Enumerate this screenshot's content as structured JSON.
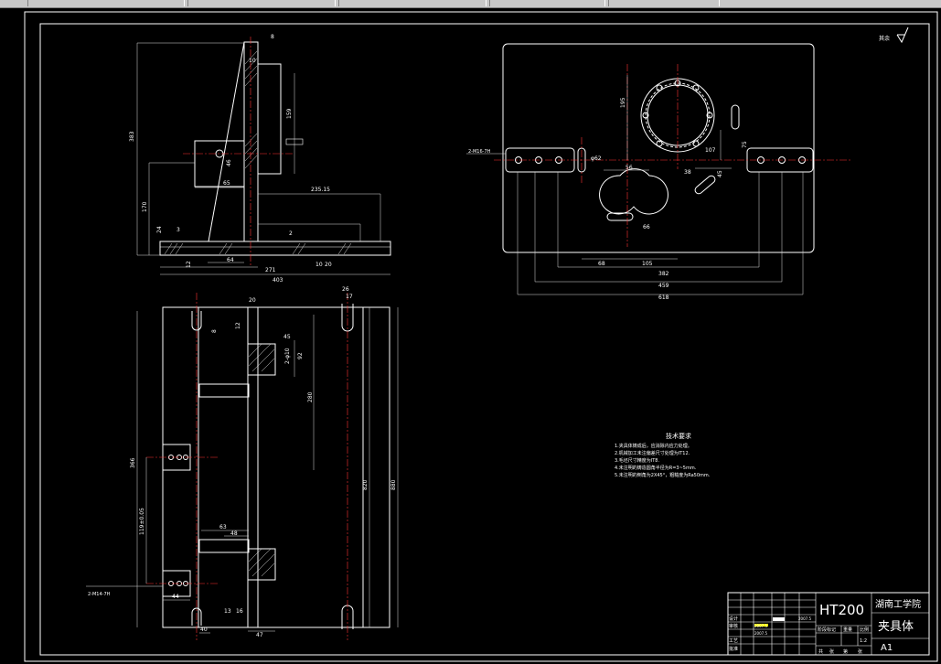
{
  "drawing": {
    "part_name": "夹具体",
    "material": "HT200",
    "school": "湖南工学院",
    "sheet_size": "A1",
    "scale": "1:2",
    "surface_mark": "其余",
    "tech_req": {
      "title": "技术要求",
      "items": [
        "1.夹具体铸成后，应消除内应力处理。",
        "2.机械加工未注偏差尺寸处理为IT12.",
        "3.毛坯尺寸精度为IT8.",
        "4.未注明的铸造圆角半径为R=3~5mm.",
        "5.未注明的倒角为2X45°，粗糙度为Ra50mm."
      ]
    },
    "title_block": {
      "stage_mark": "阶段标记",
      "weight": "重量",
      "ratio": "比例",
      "date": "2007.5",
      "rows": [
        "设计",
        "审核",
        "工艺",
        "批准"
      ],
      "bottom": [
        "共",
        "张",
        "第",
        "张"
      ]
    },
    "front_dims": [
      "8",
      "10",
      "383",
      "159",
      "65",
      "46",
      "170",
      "235.15",
      "24",
      "3",
      "64",
      "271",
      "10",
      "20",
      "12",
      "403",
      "2"
    ],
    "top_dims": [
      "26",
      "17",
      "20",
      "8",
      "12",
      "45",
      "92",
      "2-φ10",
      "280",
      "366",
      "820",
      "880",
      "119±0.05",
      "63",
      "48",
      "2-M14-7H",
      "44",
      "13",
      "16",
      "40",
      "47"
    ],
    "right_dims": [
      "2-M16-7H",
      "195",
      "φ62",
      "56",
      "107",
      "75",
      "38",
      "45",
      "66",
      "68",
      "105",
      "382",
      "459",
      "618"
    ]
  }
}
